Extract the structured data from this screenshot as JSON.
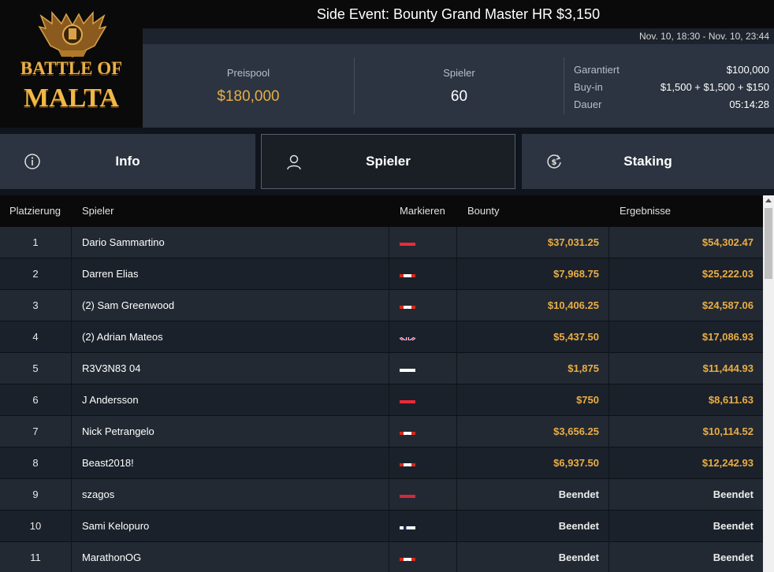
{
  "logo": {
    "line1": "BATTLE OF",
    "line2": "MALTA"
  },
  "event": {
    "title": "Side Event: Bounty Grand Master HR $3,150",
    "date_range": "Nov. 10, 18:30 - Nov. 10, 23:44"
  },
  "stats": {
    "prize_pool_label": "Preispool",
    "prize_pool_value": "$180,000",
    "players_label": "Spieler",
    "players_value": "60"
  },
  "details": {
    "guaranteed_label": "Garantiert",
    "guaranteed_value": "$100,000",
    "buyin_label": "Buy-in",
    "buyin_value": "$1,500 + $1,500 + $150",
    "duration_label": "Dauer",
    "duration_value": "05:14:28"
  },
  "tabs": {
    "info": "Info",
    "players": "Spieler",
    "staking": "Staking",
    "active": "players"
  },
  "table": {
    "headers": {
      "place": "Platzierung",
      "player": "Spieler",
      "flag": "Markieren",
      "bounty": "Bounty",
      "result": "Ergebnisse"
    },
    "rows": [
      {
        "place": "1",
        "name": "Dario Sammartino",
        "flag": "austria",
        "bounty": "$37,031.25",
        "result": "$54,302.47"
      },
      {
        "place": "2",
        "name": "Darren Elias",
        "flag": "canada",
        "bounty": "$7,968.75",
        "result": "$25,222.03"
      },
      {
        "place": "3",
        "name": "(2) Sam Greenwood",
        "flag": "canada",
        "bounty": "$10,406.25",
        "result": "$24,587.06"
      },
      {
        "place": "4",
        "name": "(2) Adrian Mateos",
        "flag": "uk",
        "bounty": "$5,437.50",
        "result": "$17,086.93"
      },
      {
        "place": "5",
        "name": "R3V3N83 04",
        "flag": "cyprus",
        "bounty": "$1,875",
        "result": "$11,444.93"
      },
      {
        "place": "6",
        "name": "J Andersson",
        "flag": "austria",
        "bounty": "$750",
        "result": "$8,611.63"
      },
      {
        "place": "7",
        "name": "Nick Petrangelo",
        "flag": "canada",
        "bounty": "$3,656.25",
        "result": "$10,114.52"
      },
      {
        "place": "8",
        "name": "Beast2018!",
        "flag": "canada",
        "bounty": "$6,937.50",
        "result": "$12,242.93"
      },
      {
        "place": "9",
        "name": "szagos",
        "flag": "hungary",
        "bounty": "Beendet",
        "result": "Beendet"
      },
      {
        "place": "10",
        "name": "Sami Kelopuro",
        "flag": "finland",
        "bounty": "Beendet",
        "result": "Beendet"
      },
      {
        "place": "11",
        "name": "MarathonOG",
        "flag": "canada",
        "bounty": "Beendet",
        "result": "Beendet"
      }
    ]
  },
  "colors": {
    "accent_gold": "#e9ad45",
    "header_bg": "#2b3440",
    "table_header_bg": "#0a0a0a"
  }
}
